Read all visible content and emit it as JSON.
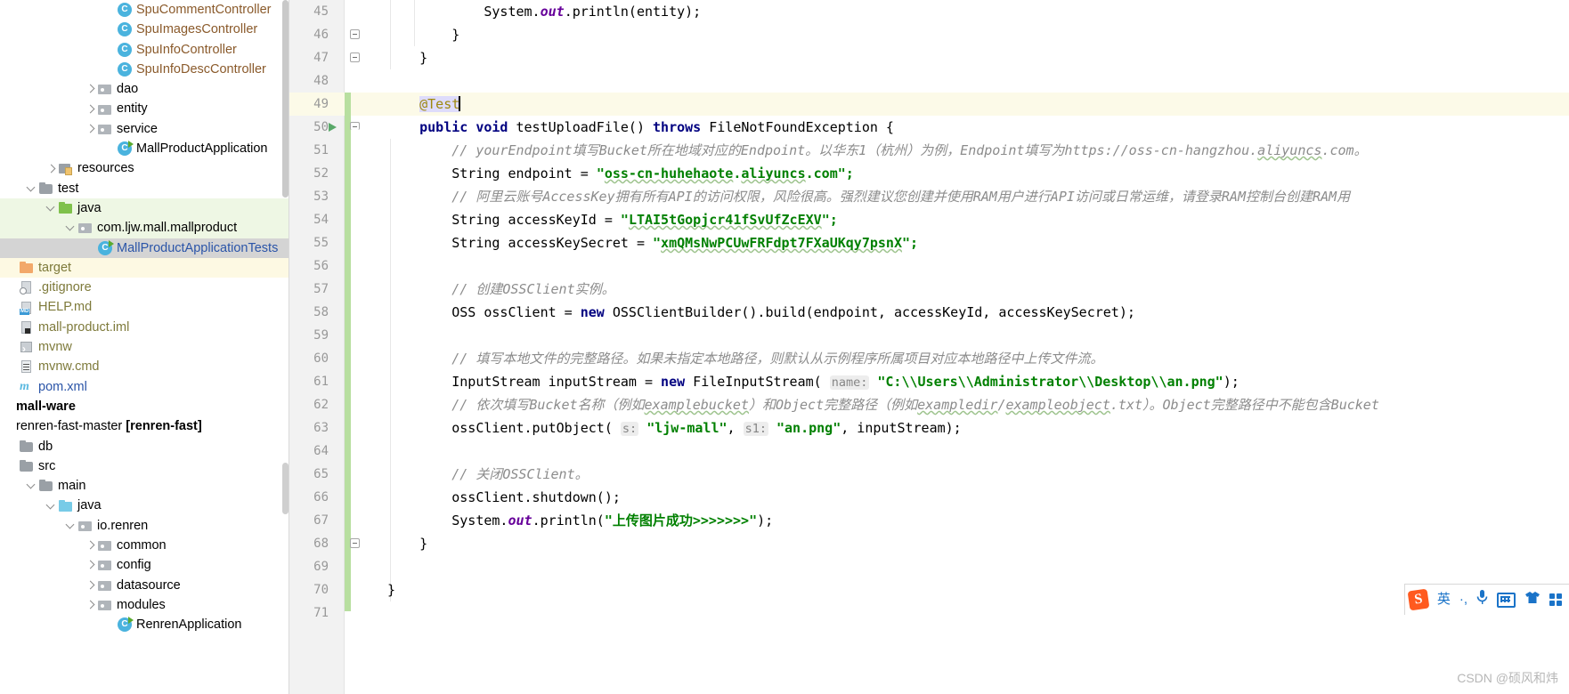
{
  "app": {
    "watermark": "CSDN @硕风和炜"
  },
  "sidebar": {
    "name": "project-tree",
    "items": [
      {
        "indent": 5,
        "twisty": "none",
        "icon": "class-icon",
        "label": "SpuCommentController",
        "style": "brown",
        "row": "normal"
      },
      {
        "indent": 5,
        "twisty": "none",
        "icon": "class-icon",
        "label": "SpuImagesController",
        "style": "brown",
        "row": "normal"
      },
      {
        "indent": 5,
        "twisty": "none",
        "icon": "class-icon",
        "label": "SpuInfoController",
        "style": "brown",
        "row": "normal"
      },
      {
        "indent": 5,
        "twisty": "none",
        "icon": "class-icon",
        "label": "SpuInfoDescController",
        "style": "brown",
        "row": "normal"
      },
      {
        "indent": 4,
        "twisty": "right",
        "icon": "package-icon",
        "label": "dao",
        "style": "plain",
        "row": "normal"
      },
      {
        "indent": 4,
        "twisty": "right",
        "icon": "package-icon",
        "label": "entity",
        "style": "plain",
        "row": "normal"
      },
      {
        "indent": 4,
        "twisty": "right",
        "icon": "package-icon",
        "label": "service",
        "style": "plain",
        "row": "normal"
      },
      {
        "indent": 5,
        "twisty": "none",
        "icon": "runnable-class-icon",
        "label": "MallProductApplication",
        "style": "plain",
        "row": "normal"
      },
      {
        "indent": 2,
        "twisty": "right",
        "icon": "resources-folder-icon",
        "label": "resources",
        "style": "plain",
        "row": "normal"
      },
      {
        "indent": 1,
        "twisty": "down",
        "icon": "folder-icon",
        "label": "test",
        "style": "plain",
        "row": "normal"
      },
      {
        "indent": 2,
        "twisty": "down",
        "icon": "folder-green-icon",
        "label": "java",
        "style": "plain",
        "row": "green"
      },
      {
        "indent": 3,
        "twisty": "down",
        "icon": "package-icon",
        "label": "com.ljw.mall.mallproduct",
        "style": "plain",
        "row": "green"
      },
      {
        "indent": 4,
        "twisty": "none",
        "icon": "runnable-class-icon",
        "label": "MallProductApplicationTests",
        "style": "blue",
        "row": "grey"
      },
      {
        "indent": 0,
        "twisty": "none",
        "icon": "folder-orange-icon",
        "label": "target",
        "style": "olive",
        "row": "cream"
      },
      {
        "indent": 0,
        "twisty": "none",
        "icon": "gitignore-file-icon",
        "label": ".gitignore",
        "style": "olive",
        "row": "normal"
      },
      {
        "indent": 0,
        "twisty": "none",
        "icon": "markdown-file-icon",
        "label": "HELP.md",
        "style": "olive",
        "row": "normal"
      },
      {
        "indent": 0,
        "twisty": "none",
        "icon": "iml-file-icon",
        "label": "mall-product.iml",
        "style": "olive",
        "row": "normal"
      },
      {
        "indent": 0,
        "twisty": "none",
        "icon": "shell-file-icon",
        "label": "mvnw",
        "style": "olive",
        "row": "normal"
      },
      {
        "indent": 0,
        "twisty": "none",
        "icon": "cmd-file-icon",
        "label": "mvnw.cmd",
        "style": "olive",
        "row": "normal"
      },
      {
        "indent": 0,
        "twisty": "none",
        "icon": "maven-file-icon",
        "label": "pom.xml",
        "style": "blue",
        "row": "normal"
      },
      {
        "indent": -1,
        "twisty": "none",
        "icon": "none",
        "label": "mall-ware",
        "style": "bold",
        "row": "normal"
      },
      {
        "indent": -1,
        "twisty": "none",
        "icon": "none",
        "label": "renren-fast-master [renren-fast]",
        "style": "module",
        "row": "normal"
      },
      {
        "indent": 0,
        "twisty": "none",
        "icon": "folder-icon",
        "label": "db",
        "style": "plain",
        "row": "normal"
      },
      {
        "indent": 0,
        "twisty": "none",
        "icon": "folder-icon",
        "label": "src",
        "style": "plain",
        "row": "normal"
      },
      {
        "indent": 1,
        "twisty": "down",
        "icon": "folder-icon",
        "label": "main",
        "style": "plain",
        "row": "normal"
      },
      {
        "indent": 2,
        "twisty": "down",
        "icon": "folder-blue-icon",
        "label": "java",
        "style": "plain",
        "row": "normal"
      },
      {
        "indent": 3,
        "twisty": "down",
        "icon": "package-icon",
        "label": "io.renren",
        "style": "plain",
        "row": "normal"
      },
      {
        "indent": 4,
        "twisty": "right",
        "icon": "package-icon",
        "label": "common",
        "style": "plain",
        "row": "normal"
      },
      {
        "indent": 4,
        "twisty": "right",
        "icon": "package-icon",
        "label": "config",
        "style": "plain",
        "row": "normal"
      },
      {
        "indent": 4,
        "twisty": "right",
        "icon": "package-icon",
        "label": "datasource",
        "style": "plain",
        "row": "normal"
      },
      {
        "indent": 4,
        "twisty": "right",
        "icon": "package-icon",
        "label": "modules",
        "style": "plain",
        "row": "normal"
      },
      {
        "indent": 5,
        "twisty": "none",
        "icon": "runnable-class-icon",
        "label": "RenrenApplication",
        "style": "plain",
        "row": "normal"
      }
    ]
  },
  "editor": {
    "name": "code-editor",
    "file_language": "java",
    "lines": [
      {
        "no": "45",
        "fold": "none",
        "run": false,
        "current": false,
        "tokens": [
          {
            "t": "            ",
            "c": "plain"
          },
          {
            "t": "System.",
            "c": "plain"
          },
          {
            "t": "out",
            "c": "stat"
          },
          {
            "t": ".println(entity);",
            "c": "plain"
          }
        ]
      },
      {
        "no": "46",
        "fold": "close",
        "run": false,
        "current": false,
        "tokens": [
          {
            "t": "        }",
            "c": "plain"
          }
        ]
      },
      {
        "no": "47",
        "fold": "close",
        "run": false,
        "current": false,
        "tokens": [
          {
            "t": "    }",
            "c": "plain"
          }
        ]
      },
      {
        "no": "48",
        "fold": "none",
        "run": false,
        "current": false,
        "tokens": [
          {
            "t": "",
            "c": "plain"
          }
        ]
      },
      {
        "no": "49",
        "fold": "none",
        "run": false,
        "current": true,
        "tokens": [
          {
            "t": "    ",
            "c": "plain"
          },
          {
            "t": "@Test",
            "c": "anno sel-token"
          },
          {
            "t": "|caret|",
            "c": "caret"
          }
        ]
      },
      {
        "no": "50",
        "fold": "open",
        "run": true,
        "current": false,
        "tokens": [
          {
            "t": "    ",
            "c": "plain"
          },
          {
            "t": "public",
            "c": "kw"
          },
          {
            "t": " ",
            "c": "plain"
          },
          {
            "t": "void",
            "c": "kw"
          },
          {
            "t": " testUploadFile() ",
            "c": "plain"
          },
          {
            "t": "throws",
            "c": "kw"
          },
          {
            "t": " FileNotFoundException {",
            "c": "plain"
          }
        ]
      },
      {
        "no": "51",
        "fold": "none",
        "run": false,
        "current": false,
        "tokens": [
          {
            "t": "        ",
            "c": "plain"
          },
          {
            "t": "// yourEndpoint填写Bucket所在地域对应的Endpoint。以华东1（杭州）为例，Endpoint填写为https://oss-cn-hangzhou.",
            "c": "cmt"
          },
          {
            "t": "aliyuncs",
            "c": "cmt squig"
          },
          {
            "t": ".com。",
            "c": "cmt"
          }
        ]
      },
      {
        "no": "52",
        "fold": "none",
        "run": false,
        "current": false,
        "tokens": [
          {
            "t": "        String endpoint = ",
            "c": "plain"
          },
          {
            "t": "\"",
            "c": "str"
          },
          {
            "t": "oss-cn-huhehaote",
            "c": "str squig"
          },
          {
            "t": ".",
            "c": "str"
          },
          {
            "t": "aliyuncs",
            "c": "str squig"
          },
          {
            "t": ".com\";",
            "c": "str"
          }
        ]
      },
      {
        "no": "53",
        "fold": "none",
        "run": false,
        "current": false,
        "tokens": [
          {
            "t": "        ",
            "c": "plain"
          },
          {
            "t": "// 阿里云账号AccessKey拥有所有API的访问权限，风险很高。强烈建议您创建并使用RAM用户进行API访问或日常运维，请登录RAM控制台创建RAM用",
            "c": "cmt"
          }
        ]
      },
      {
        "no": "54",
        "fold": "none",
        "run": false,
        "current": false,
        "tokens": [
          {
            "t": "        String accessKeyId = ",
            "c": "plain"
          },
          {
            "t": "\"",
            "c": "str"
          },
          {
            "t": "LTAI5tGopjcr41fSvUfZcEXV",
            "c": "str squig"
          },
          {
            "t": "\";",
            "c": "str"
          }
        ]
      },
      {
        "no": "55",
        "fold": "none",
        "run": false,
        "current": false,
        "tokens": [
          {
            "t": "        String accessKeySecret = ",
            "c": "plain"
          },
          {
            "t": "\"",
            "c": "str"
          },
          {
            "t": "xmQMsNwPCUwFRFdpt7FXaUKqy7psnX",
            "c": "str squig"
          },
          {
            "t": "\";",
            "c": "str"
          }
        ]
      },
      {
        "no": "56",
        "fold": "none",
        "run": false,
        "current": false,
        "tokens": [
          {
            "t": "",
            "c": "plain"
          }
        ]
      },
      {
        "no": "57",
        "fold": "none",
        "run": false,
        "current": false,
        "tokens": [
          {
            "t": "        ",
            "c": "plain"
          },
          {
            "t": "// 创建OSSClient实例。",
            "c": "cmt"
          }
        ]
      },
      {
        "no": "58",
        "fold": "none",
        "run": false,
        "current": false,
        "tokens": [
          {
            "t": "        OSS ossClient = ",
            "c": "plain"
          },
          {
            "t": "new",
            "c": "kw"
          },
          {
            "t": " OSSClientBuilder().build(endpoint, accessKeyId, accessKeySecret);",
            "c": "plain"
          }
        ]
      },
      {
        "no": "59",
        "fold": "none",
        "run": false,
        "current": false,
        "tokens": [
          {
            "t": "",
            "c": "plain"
          }
        ]
      },
      {
        "no": "60",
        "fold": "none",
        "run": false,
        "current": false,
        "tokens": [
          {
            "t": "        ",
            "c": "plain"
          },
          {
            "t": "// 填写本地文件的完整路径。如果未指定本地路径，则默认从示例程序所属项目对应本地路径中上传文件流。",
            "c": "cmt"
          }
        ]
      },
      {
        "no": "61",
        "fold": "none",
        "run": false,
        "current": false,
        "tokens": [
          {
            "t": "        InputStream inputStream = ",
            "c": "plain"
          },
          {
            "t": "new",
            "c": "kw"
          },
          {
            "t": " FileInputStream( ",
            "c": "plain"
          },
          {
            "t": "name:",
            "c": "hint"
          },
          {
            "t": " ",
            "c": "plain"
          },
          {
            "t": "\"C:\\\\Users\\\\Administrator\\\\Desktop\\\\an.png\"",
            "c": "str"
          },
          {
            "t": ");",
            "c": "plain"
          }
        ]
      },
      {
        "no": "62",
        "fold": "none",
        "run": false,
        "current": false,
        "tokens": [
          {
            "t": "        ",
            "c": "plain"
          },
          {
            "t": "// 依次填写Bucket名称（例如",
            "c": "cmt"
          },
          {
            "t": "examplebucket",
            "c": "cmt squig"
          },
          {
            "t": "）和Object完整路径（例如",
            "c": "cmt"
          },
          {
            "t": "exampledir",
            "c": "cmt squig"
          },
          {
            "t": "/",
            "c": "cmt"
          },
          {
            "t": "exampleobject",
            "c": "cmt squig"
          },
          {
            "t": ".txt）。Object完整路径中不能包含Bucket",
            "c": "cmt"
          }
        ]
      },
      {
        "no": "63",
        "fold": "none",
        "run": false,
        "current": false,
        "tokens": [
          {
            "t": "        ossClient.putObject( ",
            "c": "plain"
          },
          {
            "t": "s:",
            "c": "hint"
          },
          {
            "t": " ",
            "c": "plain"
          },
          {
            "t": "\"ljw-mall\"",
            "c": "str"
          },
          {
            "t": ", ",
            "c": "plain"
          },
          {
            "t": "s1:",
            "c": "hint"
          },
          {
            "t": " ",
            "c": "plain"
          },
          {
            "t": "\"an.png\"",
            "c": "str"
          },
          {
            "t": ", inputStream);",
            "c": "plain"
          }
        ]
      },
      {
        "no": "64",
        "fold": "none",
        "run": false,
        "current": false,
        "tokens": [
          {
            "t": "",
            "c": "plain"
          }
        ]
      },
      {
        "no": "65",
        "fold": "none",
        "run": false,
        "current": false,
        "tokens": [
          {
            "t": "        ",
            "c": "plain"
          },
          {
            "t": "// 关闭OSSClient。",
            "c": "cmt"
          }
        ]
      },
      {
        "no": "66",
        "fold": "none",
        "run": false,
        "current": false,
        "tokens": [
          {
            "t": "        ossClient.shutdown();",
            "c": "plain"
          }
        ]
      },
      {
        "no": "67",
        "fold": "none",
        "run": false,
        "current": false,
        "tokens": [
          {
            "t": "        System.",
            "c": "plain"
          },
          {
            "t": "out",
            "c": "stat"
          },
          {
            "t": ".println(",
            "c": "plain"
          },
          {
            "t": "\"上传图片成功>>>>>>>\"",
            "c": "str"
          },
          {
            "t": ");",
            "c": "plain"
          }
        ]
      },
      {
        "no": "68",
        "fold": "close",
        "run": false,
        "current": false,
        "tokens": [
          {
            "t": "    }",
            "c": "plain"
          }
        ]
      },
      {
        "no": "69",
        "fold": "none",
        "run": false,
        "current": false,
        "tokens": [
          {
            "t": "",
            "c": "plain"
          }
        ]
      },
      {
        "no": "70",
        "fold": "none",
        "run": false,
        "current": false,
        "tokens": [
          {
            "t": "}",
            "c": "plain"
          }
        ]
      },
      {
        "no": "71",
        "fold": "none",
        "run": false,
        "current": false,
        "tokens": [
          {
            "t": "",
            "c": "plain"
          }
        ]
      }
    ]
  },
  "ime_toolbar": {
    "name": "sogou-ime-toolbar",
    "logo": "S",
    "items": [
      {
        "name": "language-mode-icon",
        "glyph": "英"
      },
      {
        "name": "punctuation-icon",
        "glyph": "·,"
      },
      {
        "name": "voice-input-icon",
        "glyph": "🎤"
      },
      {
        "name": "keyboard-icon",
        "glyph": ""
      },
      {
        "name": "skin-icon",
        "glyph": "👕"
      },
      {
        "name": "toolbox-icon",
        "glyph": ""
      }
    ]
  },
  "colors": {
    "accent_green": "#59a869",
    "string_green": "#008000",
    "keyword_navy": "#000080",
    "annotation_olive": "#9e880d",
    "comment_grey": "#8c8c8c",
    "current_line": "#fcfae8",
    "selection_green": "#eef7e4",
    "selection_grey": "#d4d4d4",
    "ime_blue": "#1a73c8",
    "sogou_orange": "#ff5a1f"
  }
}
